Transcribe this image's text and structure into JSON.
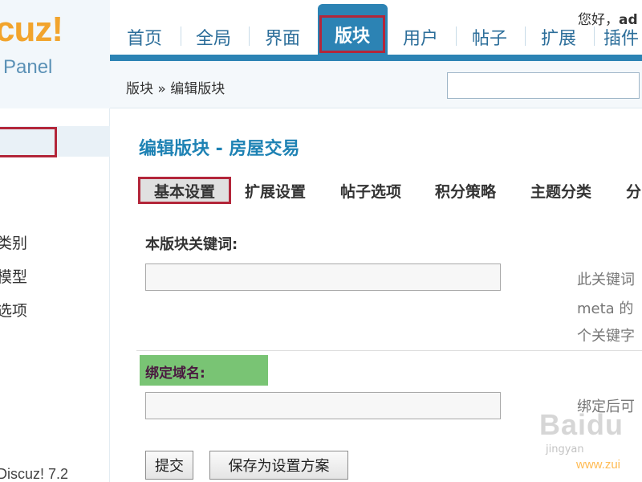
{
  "logo": {
    "text": "cuz!",
    "subtext": "Panel"
  },
  "nav": {
    "tabs": [
      {
        "label": "首页"
      },
      {
        "label": "全局"
      },
      {
        "label": "界面"
      },
      {
        "label": "版块",
        "active": true
      },
      {
        "label": "用户"
      },
      {
        "label": "帖子"
      },
      {
        "label": "扩展"
      },
      {
        "label": "插件"
      }
    ],
    "greeting": "您好，",
    "username": "ad"
  },
  "breadcrumb": {
    "text": "版块 » 编辑版块"
  },
  "sidebar": {
    "items": [
      {
        "label": "类别"
      },
      {
        "label": "模型"
      },
      {
        "label": "选项"
      }
    ],
    "copyright": "Discuz! 7.2"
  },
  "main": {
    "title": "编辑版块 - 房屋交易",
    "tabs": [
      {
        "label": "基本设置",
        "active": true
      },
      {
        "label": "扩展设置"
      },
      {
        "label": "帖子选项"
      },
      {
        "label": "积分策略"
      },
      {
        "label": "主题分类"
      },
      {
        "label": "分"
      }
    ],
    "keywords": {
      "label": "本版块关键词:",
      "value": "",
      "hint_lines": [
        "此关键词",
        "meta 的",
        "个关键字"
      ]
    },
    "domain": {
      "label": "绑定域名:",
      "value": "",
      "hint": "绑定后可"
    },
    "buttons": {
      "submit": "提交",
      "save_scheme": "保存为设置方案"
    }
  },
  "watermark": {
    "text": "Baidu",
    "sub": "jingyan",
    "url": "www.zui"
  },
  "colors": {
    "accent": "#2c83b4",
    "highlight_border": "#b3263a",
    "label_green": "#79c474",
    "title_blue": "#1e82b4"
  }
}
